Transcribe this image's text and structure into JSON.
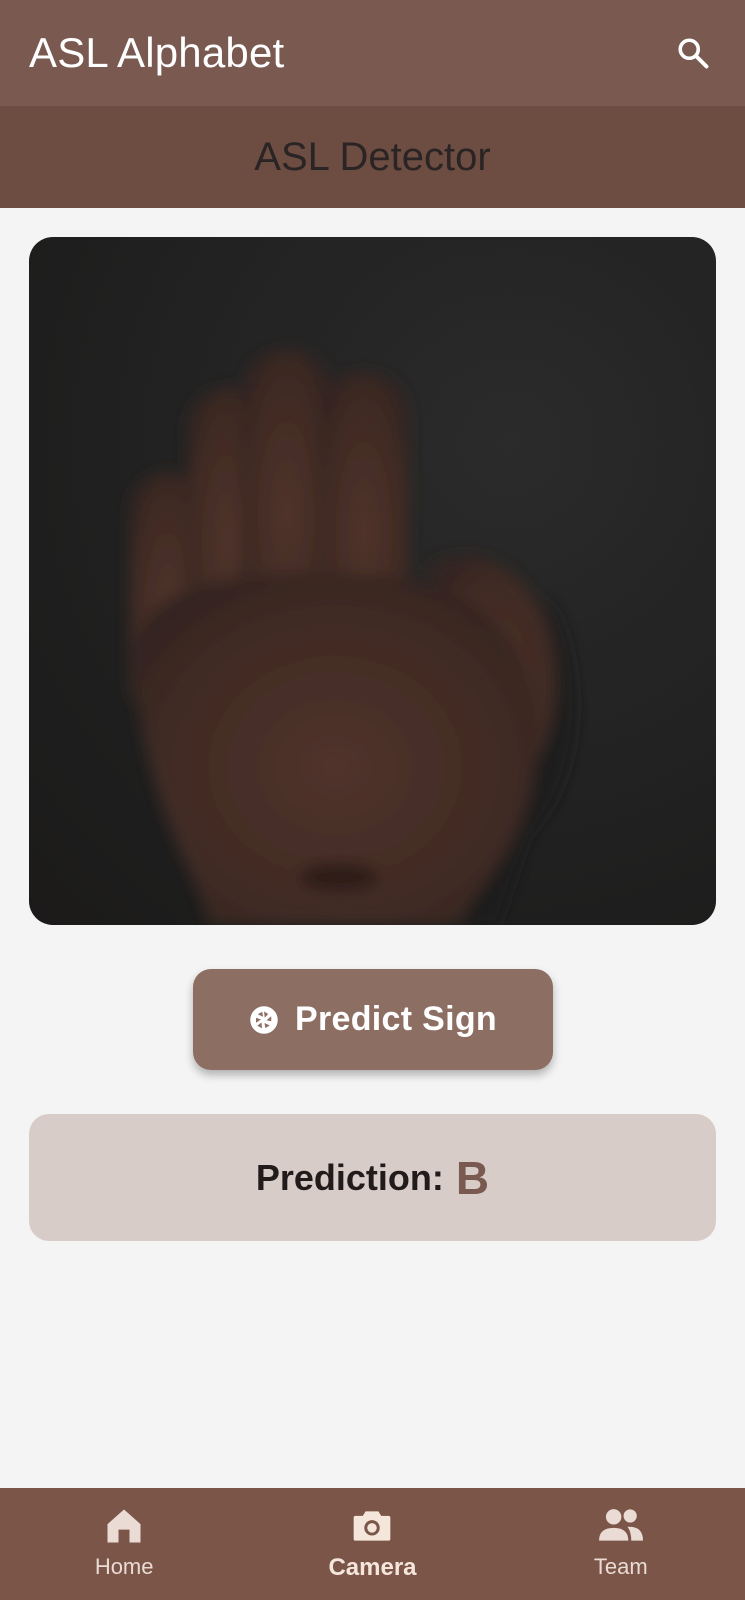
{
  "app_bar": {
    "title": "ASL Alphabet",
    "search_icon": "search-icon"
  },
  "sub_header": {
    "title": "ASL Detector"
  },
  "camera": {
    "content": "hand-image"
  },
  "predict_button": {
    "icon": "camera-shutter-icon",
    "label": "Predict Sign"
  },
  "prediction": {
    "label": "Prediction:",
    "value": "B"
  },
  "bottom_nav": {
    "items": [
      {
        "label": "Home",
        "icon": "home-icon",
        "active": false
      },
      {
        "label": "Camera",
        "icon": "camera-icon",
        "active": true
      },
      {
        "label": "Team",
        "icon": "team-icon",
        "active": false
      }
    ]
  },
  "colors": {
    "app_bar": "#7a5a50",
    "sub_header": "#6d4d42",
    "button": "#8d6e63",
    "prediction_card": "#d8ccc8",
    "prediction_value": "#7a5a50",
    "bottom_nav": "#7a5548"
  }
}
